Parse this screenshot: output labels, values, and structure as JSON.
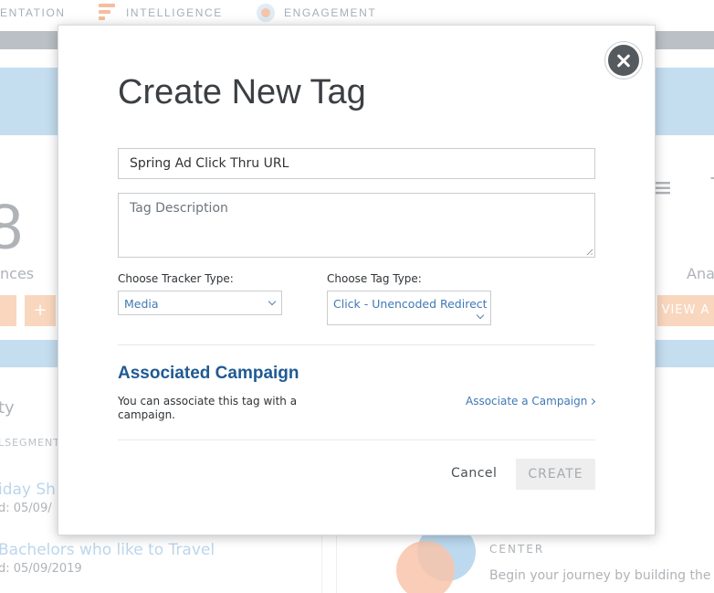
{
  "background": {
    "nav": {
      "segmentation": "ENTATION",
      "intelligence": "INTELLIGENCE",
      "engagement": "ENGAGEMENT"
    },
    "stats": {
      "big_number": "8",
      "label": "nces",
      "right_label": "Ana"
    },
    "buttons": {
      "plus": "+",
      "view": "VIEW A"
    },
    "left_panel": {
      "title": "ty",
      "subtitle": "LSEGMENT",
      "items": [
        {
          "name": "iday Sh",
          "date": "d: 05/09/"
        },
        {
          "name": "Bachelors who like to Travel",
          "date": "d: 05/09/2019"
        }
      ]
    },
    "right_panel": {
      "center_label": "CENTER",
      "text": "Begin your journey by building the p"
    }
  },
  "modal": {
    "title": "Create New Tag",
    "tag_name_value": "Spring Ad Click Thru URL",
    "tag_description_placeholder": "Tag Description",
    "tracker_type_label": "Choose Tracker Type:",
    "tracker_type_value": "Media",
    "tag_type_label": "Choose Tag Type:",
    "tag_type_value": "Click - Unencoded Redirect",
    "associated_campaign": {
      "title": "Associated Campaign",
      "description": "You can associate this tag with a campaign.",
      "link": "Associate a Campaign"
    },
    "cancel_label": "Cancel",
    "create_label": "CREATE"
  },
  "colors": {
    "accent_blue": "#1f5a93",
    "link_blue": "#3f78b5",
    "hero_blue": "#a9cde8",
    "orange": "#f6c49f",
    "close_button": "#555a5e"
  }
}
